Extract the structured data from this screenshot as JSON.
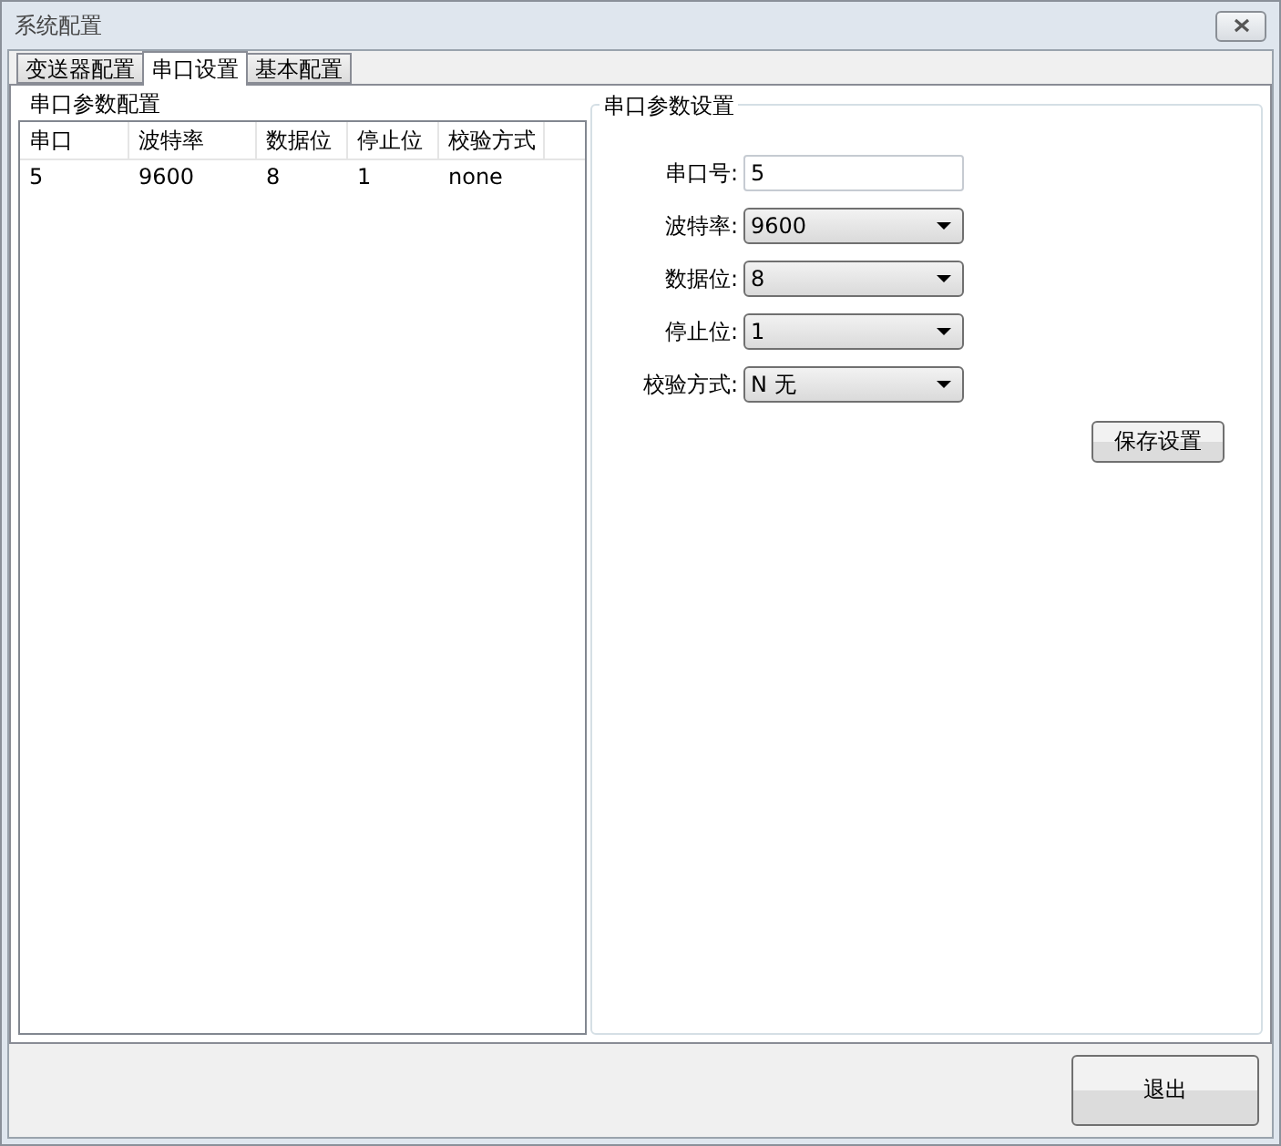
{
  "window": {
    "title": "系统配置"
  },
  "tabs": [
    {
      "label": "变送器配置",
      "selected": false
    },
    {
      "label": "串口设置",
      "selected": true
    },
    {
      "label": "基本配置",
      "selected": false
    }
  ],
  "list_group": {
    "title": "串口参数配置",
    "columns": [
      "串口",
      "波特率",
      "数据位",
      "停止位",
      "校验方式"
    ],
    "rows": [
      [
        "5",
        "9600",
        "8",
        "1",
        "none"
      ]
    ]
  },
  "settings_group": {
    "title": "串口参数设置",
    "fields": [
      {
        "label": "串口号:",
        "kind": "text",
        "value": "5"
      },
      {
        "label": "波特率:",
        "kind": "dropdown",
        "value": "9600"
      },
      {
        "label": "数据位:",
        "kind": "dropdown",
        "value": "8"
      },
      {
        "label": "停止位:",
        "kind": "dropdown",
        "value": "1"
      },
      {
        "label": "校验方式:",
        "kind": "dropdown",
        "value": "N 无"
      }
    ],
    "save_button": "保存设置"
  },
  "exit_button": "退出"
}
